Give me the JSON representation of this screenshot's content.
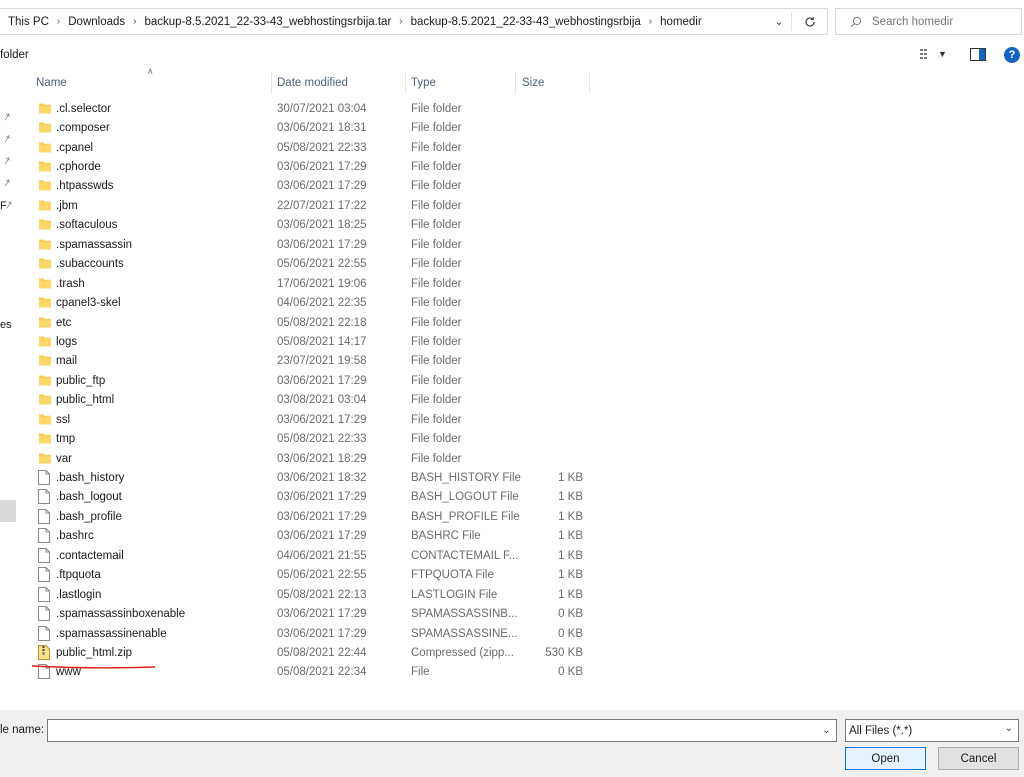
{
  "address": {
    "crumbs": [
      "This PC",
      "Downloads",
      "backup-8.5.2021_22-33-43_webhostingsrbija.tar",
      "backup-8.5.2021_22-33-43_webhostingsrbija",
      "homedir"
    ]
  },
  "search": {
    "placeholder": "Search homedir"
  },
  "toolbar": {
    "new_folder_label": "folder"
  },
  "nav": {
    "fragment_label": "es",
    "fragment_2": "F"
  },
  "columns": {
    "name": "Name",
    "date": "Date modified",
    "type": "Type",
    "size": "Size"
  },
  "files": [
    {
      "name": ".cl.selector",
      "date": "30/07/2021 03:04",
      "type": "File folder",
      "size": "",
      "icon": "folder-icon"
    },
    {
      "name": ".composer",
      "date": "03/06/2021 18:31",
      "type": "File folder",
      "size": "",
      "icon": "folder-icon"
    },
    {
      "name": ".cpanel",
      "date": "05/08/2021 22:33",
      "type": "File folder",
      "size": "",
      "icon": "folder-icon"
    },
    {
      "name": ".cphorde",
      "date": "03/06/2021 17:29",
      "type": "File folder",
      "size": "",
      "icon": "folder-icon"
    },
    {
      "name": ".htpasswds",
      "date": "03/06/2021 17:29",
      "type": "File folder",
      "size": "",
      "icon": "folder-icon"
    },
    {
      "name": ".jbm",
      "date": "22/07/2021 17:22",
      "type": "File folder",
      "size": "",
      "icon": "folder-icon"
    },
    {
      "name": ".softaculous",
      "date": "03/06/2021 18:25",
      "type": "File folder",
      "size": "",
      "icon": "folder-icon"
    },
    {
      "name": ".spamassassin",
      "date": "03/06/2021 17:29",
      "type": "File folder",
      "size": "",
      "icon": "folder-icon"
    },
    {
      "name": ".subaccounts",
      "date": "05/06/2021 22:55",
      "type": "File folder",
      "size": "",
      "icon": "folder-icon"
    },
    {
      "name": ".trash",
      "date": "17/06/2021 19:06",
      "type": "File folder",
      "size": "",
      "icon": "folder-icon"
    },
    {
      "name": "cpanel3-skel",
      "date": "04/06/2021 22:35",
      "type": "File folder",
      "size": "",
      "icon": "folder-icon"
    },
    {
      "name": "etc",
      "date": "05/08/2021 22:18",
      "type": "File folder",
      "size": "",
      "icon": "folder-icon"
    },
    {
      "name": "logs",
      "date": "05/08/2021 14:17",
      "type": "File folder",
      "size": "",
      "icon": "folder-icon"
    },
    {
      "name": "mail",
      "date": "23/07/2021 19:58",
      "type": "File folder",
      "size": "",
      "icon": "folder-icon"
    },
    {
      "name": "public_ftp",
      "date": "03/06/2021 17:29",
      "type": "File folder",
      "size": "",
      "icon": "folder-icon"
    },
    {
      "name": "public_html",
      "date": "03/08/2021 03:04",
      "type": "File folder",
      "size": "",
      "icon": "folder-icon"
    },
    {
      "name": "ssl",
      "date": "03/06/2021 17:29",
      "type": "File folder",
      "size": "",
      "icon": "folder-icon"
    },
    {
      "name": "tmp",
      "date": "05/08/2021 22:33",
      "type": "File folder",
      "size": "",
      "icon": "folder-icon"
    },
    {
      "name": "var",
      "date": "03/06/2021 18:29",
      "type": "File folder",
      "size": "",
      "icon": "folder-icon"
    },
    {
      "name": ".bash_history",
      "date": "03/06/2021 18:32",
      "type": "BASH_HISTORY File",
      "size": "1 KB",
      "icon": "file-icon"
    },
    {
      "name": ".bash_logout",
      "date": "03/06/2021 17:29",
      "type": "BASH_LOGOUT File",
      "size": "1 KB",
      "icon": "file-icon"
    },
    {
      "name": ".bash_profile",
      "date": "03/06/2021 17:29",
      "type": "BASH_PROFILE File",
      "size": "1 KB",
      "icon": "file-icon"
    },
    {
      "name": ".bashrc",
      "date": "03/06/2021 17:29",
      "type": "BASHRC File",
      "size": "1 KB",
      "icon": "file-icon"
    },
    {
      "name": ".contactemail",
      "date": "04/06/2021 21:55",
      "type": "CONTACTEMAIL F...",
      "size": "1 KB",
      "icon": "file-icon"
    },
    {
      "name": ".ftpquota",
      "date": "05/06/2021 22:55",
      "type": "FTPQUOTA File",
      "size": "1 KB",
      "icon": "file-icon"
    },
    {
      "name": ".lastlogin",
      "date": "05/08/2021 22:13",
      "type": "LASTLOGIN File",
      "size": "1 KB",
      "icon": "file-icon"
    },
    {
      "name": ".spamassassinboxenable",
      "date": "03/06/2021 17:29",
      "type": "SPAMASSASSINB...",
      "size": "0 KB",
      "icon": "file-icon"
    },
    {
      "name": ".spamassassinenable",
      "date": "03/06/2021 17:29",
      "type": "SPAMASSASSINE...",
      "size": "0 KB",
      "icon": "file-icon"
    },
    {
      "name": "public_html.zip",
      "date": "05/08/2021 22:44",
      "type": "Compressed (zipp...",
      "size": "530 KB",
      "icon": "zip-file-icon"
    },
    {
      "name": "www",
      "date": "05/08/2021 22:34",
      "type": "File",
      "size": "0 KB",
      "icon": "file-icon"
    }
  ],
  "bottom": {
    "file_name_label": "le name:",
    "file_name_value": "",
    "file_type_value": "All Files (*.*)",
    "open_label": "Open",
    "cancel_label": "Cancel"
  },
  "colors": {
    "folder": "#ffd766",
    "accent": "#0078d7",
    "annotation_underline": "#e0201a"
  }
}
